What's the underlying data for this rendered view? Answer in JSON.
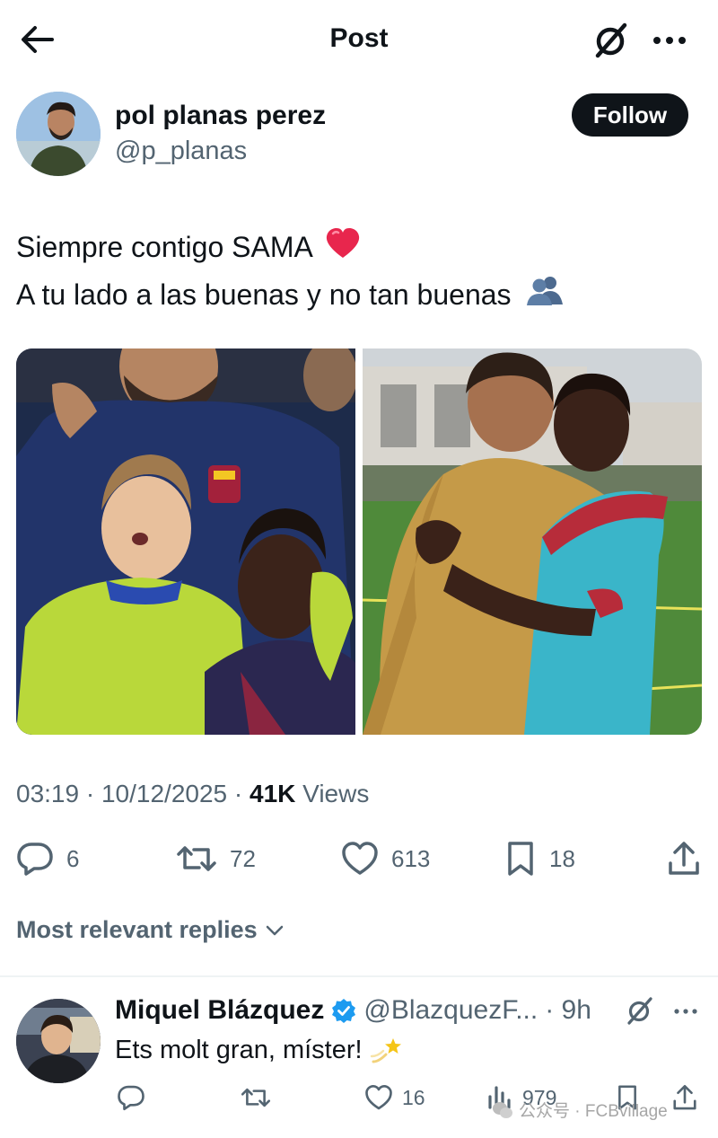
{
  "header": {
    "title": "Post",
    "back_icon": "arrow-left-icon",
    "grok_icon": "grok-icon",
    "more_icon": "more-dots-icon"
  },
  "author": {
    "name": "pol planas perez",
    "handle": "@p_planas",
    "follow_label": "Follow"
  },
  "tweet": {
    "line1": "Siempre contigo SAMA",
    "line2": "A tu lado a las buenas y no tan buenas",
    "emoji1": "red-heart",
    "emoji2": "busts-in-silhouette"
  },
  "meta": {
    "time": "03:19",
    "separator": "·",
    "date": "10/12/2025",
    "views_count": "41K",
    "views_label": "Views"
  },
  "actions": {
    "replies": "6",
    "reposts": "72",
    "likes": "613",
    "bookmarks": "18"
  },
  "replies_filter": {
    "label": "Most relevant replies"
  },
  "reply": {
    "name": "Miquel Blázquez",
    "handle": "@BlazquezF...",
    "time": "· 9h",
    "text": "Ets molt gran, míster!",
    "likes": "16",
    "views": "979"
  },
  "watermark": {
    "text": "公众号 · FCBvillage"
  },
  "colors": {
    "text": "#0f1419",
    "secondary": "#536471",
    "verified": "#1d9bf0",
    "heart": "#e0245e"
  }
}
